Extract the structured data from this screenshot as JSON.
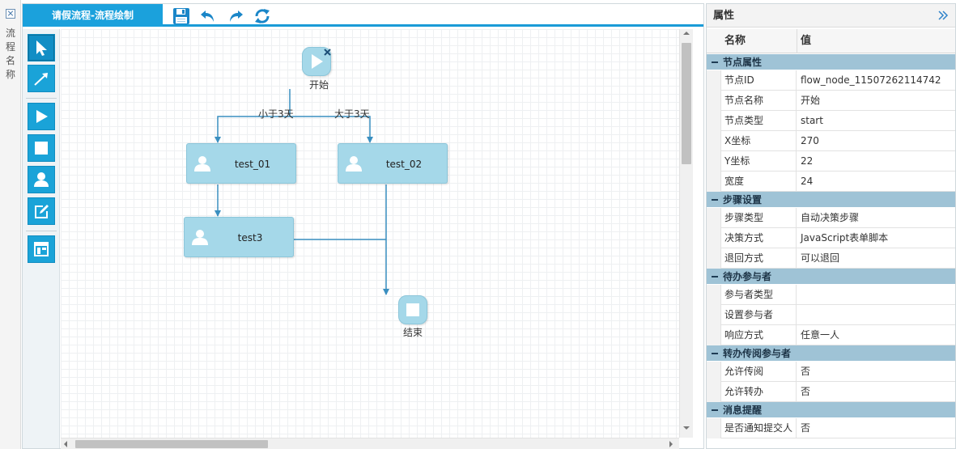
{
  "left_strip": {
    "title": "流程名称"
  },
  "designer": {
    "title": "请假流程-流程绘制",
    "toolbar": [
      {
        "icon": "save-icon"
      },
      {
        "icon": "undo-icon"
      },
      {
        "icon": "redo-icon"
      },
      {
        "icon": "refresh-icon"
      }
    ],
    "palette": [
      {
        "icon": "pointer-icon"
      },
      {
        "icon": "connector-arrow-icon"
      },
      {
        "icon": "start-node-icon"
      },
      {
        "icon": "end-node-icon"
      },
      {
        "icon": "user-task-icon"
      },
      {
        "icon": "form-task-icon"
      },
      {
        "icon": "layout-icon"
      }
    ]
  },
  "flow": {
    "nodes": {
      "start": {
        "label": "开始"
      },
      "test_01": {
        "label": "test_01"
      },
      "test_02": {
        "label": "test_02"
      },
      "test3": {
        "label": "test3"
      },
      "end": {
        "label": "结束"
      }
    },
    "edges": {
      "less_than_3": {
        "label": "小于3天"
      },
      "more_than_3": {
        "label": "大于3天"
      }
    }
  },
  "props": {
    "title": "属性",
    "col_name": "名称",
    "col_value": "值",
    "groups": [
      {
        "label": "节点属性",
        "rows": [
          {
            "name": "节点ID",
            "value": "flow_node_11507262114742"
          },
          {
            "name": "节点名称",
            "value": "开始"
          },
          {
            "name": "节点类型",
            "value": "start"
          },
          {
            "name": "X坐标",
            "value": "270"
          },
          {
            "name": "Y坐标",
            "value": "22"
          },
          {
            "name": "宽度",
            "value": "24"
          }
        ]
      },
      {
        "label": "步骤设置",
        "rows": [
          {
            "name": "步骤类型",
            "value": "自动决策步骤"
          },
          {
            "name": "决策方式",
            "value": "JavaScript表单脚本"
          },
          {
            "name": "退回方式",
            "value": "可以退回"
          }
        ]
      },
      {
        "label": "待办参与者",
        "rows": [
          {
            "name": "参与者类型",
            "value": ""
          },
          {
            "name": "设置参与者",
            "value": ""
          },
          {
            "name": "响应方式",
            "value": "任意一人"
          }
        ]
      },
      {
        "label": "转办传阅参与者",
        "rows": [
          {
            "name": "允许传阅",
            "value": "否"
          },
          {
            "name": "允许转办",
            "value": "否"
          }
        ]
      },
      {
        "label": "消息提醒",
        "rows": [
          {
            "name": "是否通知提交人",
            "value": "否"
          }
        ]
      }
    ]
  },
  "colors": {
    "accent": "#1ba1dc",
    "node_fill": "#a5d8e9",
    "edge": "#3a8fc0",
    "group_header": "#9fc3d6"
  }
}
